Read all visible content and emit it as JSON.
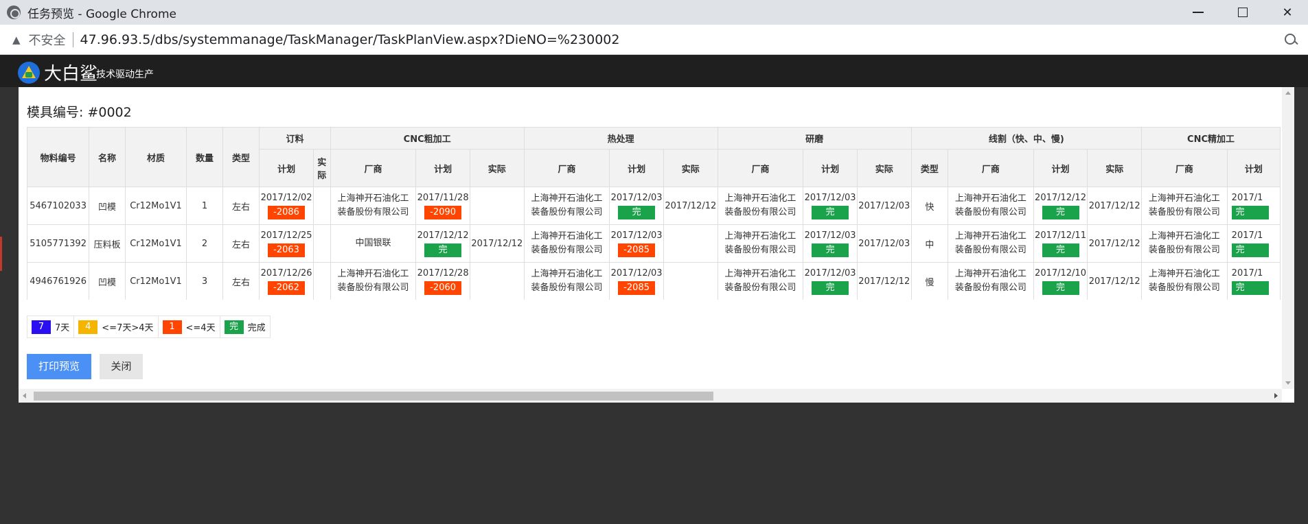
{
  "window": {
    "title": "任务预览 - Google Chrome"
  },
  "address": {
    "security": "不安全",
    "url": "47.96.93.5/dbs/systemmanage/TaskManager/TaskPlanView.aspx?DieNO=%230002"
  },
  "app": {
    "brand": "大白鲨",
    "slogan": "技术驱动生产"
  },
  "page": {
    "mold_label": "模具编号:",
    "mold_no": "#0002"
  },
  "table": {
    "fixed_headers": [
      "物料编号",
      "名称",
      "材质",
      "数量",
      "类型"
    ],
    "groups": [
      "订料",
      "CNC粗加工",
      "热处理",
      "研磨",
      "线割（快、中、慢)",
      "CNC精加工"
    ],
    "sub": {
      "plan": "计划",
      "actual": "实际",
      "vendor": "厂商",
      "type": "类型"
    },
    "rows": [
      {
        "material_no": "5467102033",
        "name": "凹模",
        "material": "Cr12Mo1V1",
        "qty": "1",
        "type": "左右",
        "order_plan": "2017/12/02",
        "order_tag": "-2086",
        "order_actual": "",
        "cnc_vendor": "上海神开石油化工装备股份有限公司",
        "cnc_plan": "2017/11/28",
        "cnc_tag": "-2090",
        "cnc_actual": "",
        "heat_vendor": "上海神开石油化工装备股份有限公司",
        "heat_plan": "2017/12/03",
        "heat_tag": "完",
        "heat_actual": "2017/12/12",
        "grind_vendor": "上海神开石油化工装备股份有限公司",
        "grind_plan": "2017/12/03",
        "grind_tag": "完",
        "grind_actual": "2017/12/03",
        "wire_type": "快",
        "wire_vendor": "上海神开石油化工装备股份有限公司",
        "wire_plan": "2017/12/12",
        "wire_tag": "完",
        "wire_actual": "2017/12/12",
        "fine_vendor": "上海神开石油化工装备股份有限公司",
        "fine_plan": "2017/1",
        "fine_tag": "完"
      },
      {
        "material_no": "5105771392",
        "name": "压料板",
        "material": "Cr12Mo1V1",
        "qty": "2",
        "type": "左右",
        "order_plan": "2017/12/25",
        "order_tag": "-2063",
        "order_actual": "",
        "cnc_vendor": "中国银联",
        "cnc_plan": "2017/12/12",
        "cnc_tag": "完",
        "cnc_actual": "2017/12/12",
        "heat_vendor": "上海神开石油化工装备股份有限公司",
        "heat_plan": "2017/12/03",
        "heat_tag": "-2085",
        "heat_actual": "",
        "grind_vendor": "上海神开石油化工装备股份有限公司",
        "grind_plan": "2017/12/03",
        "grind_tag": "完",
        "grind_actual": "2017/12/03",
        "wire_type": "中",
        "wire_vendor": "上海神开石油化工装备股份有限公司",
        "wire_plan": "2017/12/11",
        "wire_tag": "完",
        "wire_actual": "2017/12/12",
        "fine_vendor": "上海神开石油化工装备股份有限公司",
        "fine_plan": "2017/1",
        "fine_tag": "完"
      },
      {
        "material_no": "4946761926",
        "name": "凹模",
        "material": "Cr12Mo1V1",
        "qty": "3",
        "type": "左右",
        "order_plan": "2017/12/26",
        "order_tag": "-2062",
        "order_actual": "",
        "cnc_vendor": "上海神开石油化工装备股份有限公司",
        "cnc_plan": "2017/12/28",
        "cnc_tag": "-2060",
        "cnc_actual": "",
        "heat_vendor": "上海神开石油化工装备股份有限公司",
        "heat_plan": "2017/12/03",
        "heat_tag": "-2085",
        "heat_actual": "",
        "grind_vendor": "上海神开石油化工装备股份有限公司",
        "grind_plan": "2017/12/03",
        "grind_tag": "完",
        "grind_actual": "2017/12/12",
        "wire_type": "慢",
        "wire_vendor": "上海神开石油化工装备股份有限公司",
        "wire_plan": "2017/12/10",
        "wire_tag": "完",
        "wire_actual": "2017/12/12",
        "fine_vendor": "上海神开石油化工装备股份有限公司",
        "fine_plan": "2017/1",
        "fine_tag": "完"
      }
    ]
  },
  "legend": [
    {
      "swatch": "7",
      "label": "7天",
      "color": "#2a10f0"
    },
    {
      "swatch": "4",
      "label": "<=7天>4天",
      "color": "#f5b400"
    },
    {
      "swatch": "1",
      "label": "<=4天",
      "color": "#ff4500"
    },
    {
      "swatch": "完",
      "label": "完成",
      "color": "#1aa34a"
    }
  ],
  "buttons": {
    "print": "打印预览",
    "close": "关闭"
  },
  "colors": {
    "late": "#ff4500",
    "done": "#1aa34a",
    "primary": "#4a90f5"
  }
}
